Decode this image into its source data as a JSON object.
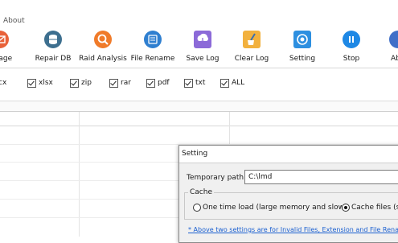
{
  "menubar": {
    "about": "About"
  },
  "toolbar": {
    "buttons": [
      {
        "label": "Image",
        "icon": "envelope-icon",
        "color": "#e8623a"
      },
      {
        "label": "Repair DB",
        "icon": "database-icon",
        "color": "#3d6f8f"
      },
      {
        "label": "Raid Analysis",
        "icon": "magnifier-icon",
        "color": "#f07b2a"
      },
      {
        "label": "File Rename",
        "icon": "rename-icon",
        "color": "#2f7fd0"
      },
      {
        "label": "Save Log",
        "icon": "save-log-icon",
        "color": "#8c6ad8"
      },
      {
        "label": "Clear Log",
        "icon": "broom-icon",
        "color": "#f2b13e"
      },
      {
        "label": "Setting",
        "icon": "gear-icon",
        "color": "#2d8fe0"
      },
      {
        "label": "Stop",
        "icon": "pause-icon",
        "color": "#1e88e5"
      },
      {
        "label": "Ab",
        "icon": "about-icon",
        "color": "#3f6fc8"
      }
    ]
  },
  "filters": {
    "partial": "cx",
    "items": [
      "xlsx",
      "zip",
      "rar",
      "pdf",
      "txt",
      "ALL"
    ]
  },
  "dialog": {
    "title": "Setting",
    "temp_path_label": "Temporary path:",
    "temp_path_value": "C:\\lmd",
    "cache_label": "Cache",
    "option_one_time": "One time load (large memory and slow)",
    "option_cache_files": "Cache files (sm",
    "note": "* Above two settings are for Invalid Files, Extension and File Rena"
  }
}
